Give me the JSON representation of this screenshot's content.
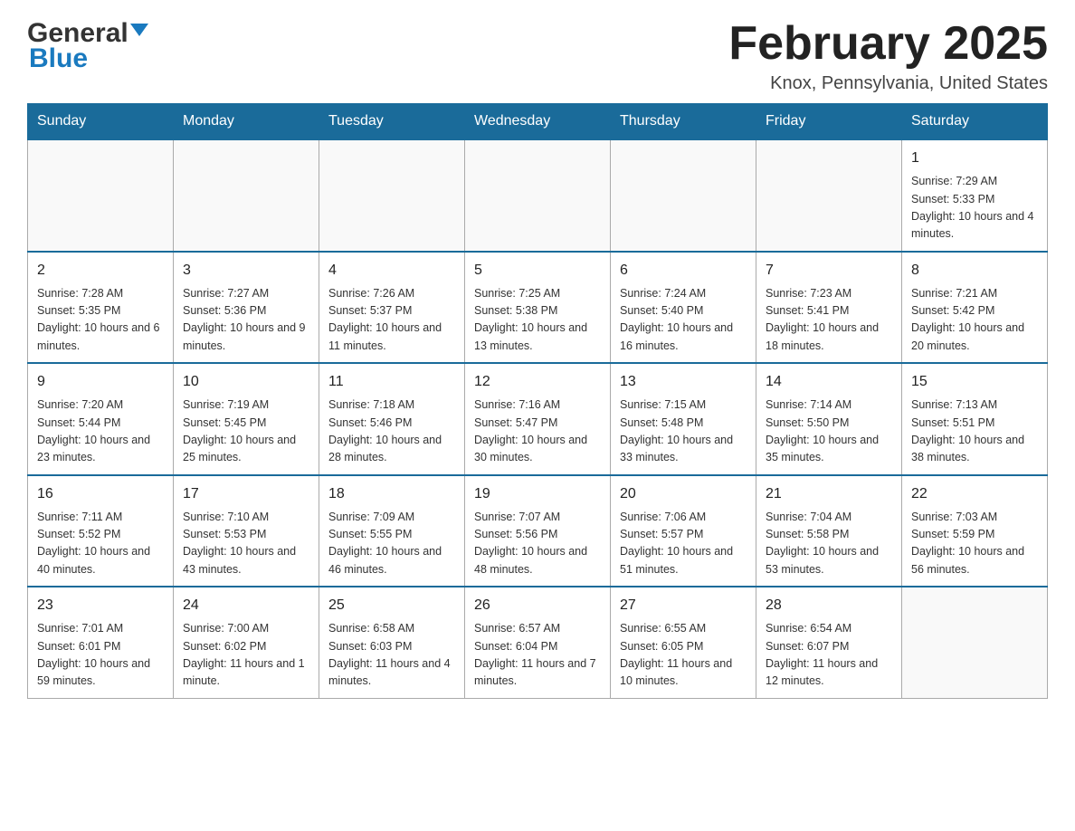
{
  "header": {
    "logo_general": "General",
    "logo_blue": "Blue",
    "title": "February 2025",
    "subtitle": "Knox, Pennsylvania, United States"
  },
  "days_of_week": [
    "Sunday",
    "Monday",
    "Tuesday",
    "Wednesday",
    "Thursday",
    "Friday",
    "Saturday"
  ],
  "weeks": [
    [
      {
        "num": "",
        "info": ""
      },
      {
        "num": "",
        "info": ""
      },
      {
        "num": "",
        "info": ""
      },
      {
        "num": "",
        "info": ""
      },
      {
        "num": "",
        "info": ""
      },
      {
        "num": "",
        "info": ""
      },
      {
        "num": "1",
        "info": "Sunrise: 7:29 AM\nSunset: 5:33 PM\nDaylight: 10 hours and 4 minutes."
      }
    ],
    [
      {
        "num": "2",
        "info": "Sunrise: 7:28 AM\nSunset: 5:35 PM\nDaylight: 10 hours and 6 minutes."
      },
      {
        "num": "3",
        "info": "Sunrise: 7:27 AM\nSunset: 5:36 PM\nDaylight: 10 hours and 9 minutes."
      },
      {
        "num": "4",
        "info": "Sunrise: 7:26 AM\nSunset: 5:37 PM\nDaylight: 10 hours and 11 minutes."
      },
      {
        "num": "5",
        "info": "Sunrise: 7:25 AM\nSunset: 5:38 PM\nDaylight: 10 hours and 13 minutes."
      },
      {
        "num": "6",
        "info": "Sunrise: 7:24 AM\nSunset: 5:40 PM\nDaylight: 10 hours and 16 minutes."
      },
      {
        "num": "7",
        "info": "Sunrise: 7:23 AM\nSunset: 5:41 PM\nDaylight: 10 hours and 18 minutes."
      },
      {
        "num": "8",
        "info": "Sunrise: 7:21 AM\nSunset: 5:42 PM\nDaylight: 10 hours and 20 minutes."
      }
    ],
    [
      {
        "num": "9",
        "info": "Sunrise: 7:20 AM\nSunset: 5:44 PM\nDaylight: 10 hours and 23 minutes."
      },
      {
        "num": "10",
        "info": "Sunrise: 7:19 AM\nSunset: 5:45 PM\nDaylight: 10 hours and 25 minutes."
      },
      {
        "num": "11",
        "info": "Sunrise: 7:18 AM\nSunset: 5:46 PM\nDaylight: 10 hours and 28 minutes."
      },
      {
        "num": "12",
        "info": "Sunrise: 7:16 AM\nSunset: 5:47 PM\nDaylight: 10 hours and 30 minutes."
      },
      {
        "num": "13",
        "info": "Sunrise: 7:15 AM\nSunset: 5:48 PM\nDaylight: 10 hours and 33 minutes."
      },
      {
        "num": "14",
        "info": "Sunrise: 7:14 AM\nSunset: 5:50 PM\nDaylight: 10 hours and 35 minutes."
      },
      {
        "num": "15",
        "info": "Sunrise: 7:13 AM\nSunset: 5:51 PM\nDaylight: 10 hours and 38 minutes."
      }
    ],
    [
      {
        "num": "16",
        "info": "Sunrise: 7:11 AM\nSunset: 5:52 PM\nDaylight: 10 hours and 40 minutes."
      },
      {
        "num": "17",
        "info": "Sunrise: 7:10 AM\nSunset: 5:53 PM\nDaylight: 10 hours and 43 minutes."
      },
      {
        "num": "18",
        "info": "Sunrise: 7:09 AM\nSunset: 5:55 PM\nDaylight: 10 hours and 46 minutes."
      },
      {
        "num": "19",
        "info": "Sunrise: 7:07 AM\nSunset: 5:56 PM\nDaylight: 10 hours and 48 minutes."
      },
      {
        "num": "20",
        "info": "Sunrise: 7:06 AM\nSunset: 5:57 PM\nDaylight: 10 hours and 51 minutes."
      },
      {
        "num": "21",
        "info": "Sunrise: 7:04 AM\nSunset: 5:58 PM\nDaylight: 10 hours and 53 minutes."
      },
      {
        "num": "22",
        "info": "Sunrise: 7:03 AM\nSunset: 5:59 PM\nDaylight: 10 hours and 56 minutes."
      }
    ],
    [
      {
        "num": "23",
        "info": "Sunrise: 7:01 AM\nSunset: 6:01 PM\nDaylight: 10 hours and 59 minutes."
      },
      {
        "num": "24",
        "info": "Sunrise: 7:00 AM\nSunset: 6:02 PM\nDaylight: 11 hours and 1 minute."
      },
      {
        "num": "25",
        "info": "Sunrise: 6:58 AM\nSunset: 6:03 PM\nDaylight: 11 hours and 4 minutes."
      },
      {
        "num": "26",
        "info": "Sunrise: 6:57 AM\nSunset: 6:04 PM\nDaylight: 11 hours and 7 minutes."
      },
      {
        "num": "27",
        "info": "Sunrise: 6:55 AM\nSunset: 6:05 PM\nDaylight: 11 hours and 10 minutes."
      },
      {
        "num": "28",
        "info": "Sunrise: 6:54 AM\nSunset: 6:07 PM\nDaylight: 11 hours and 12 minutes."
      },
      {
        "num": "",
        "info": ""
      }
    ]
  ]
}
